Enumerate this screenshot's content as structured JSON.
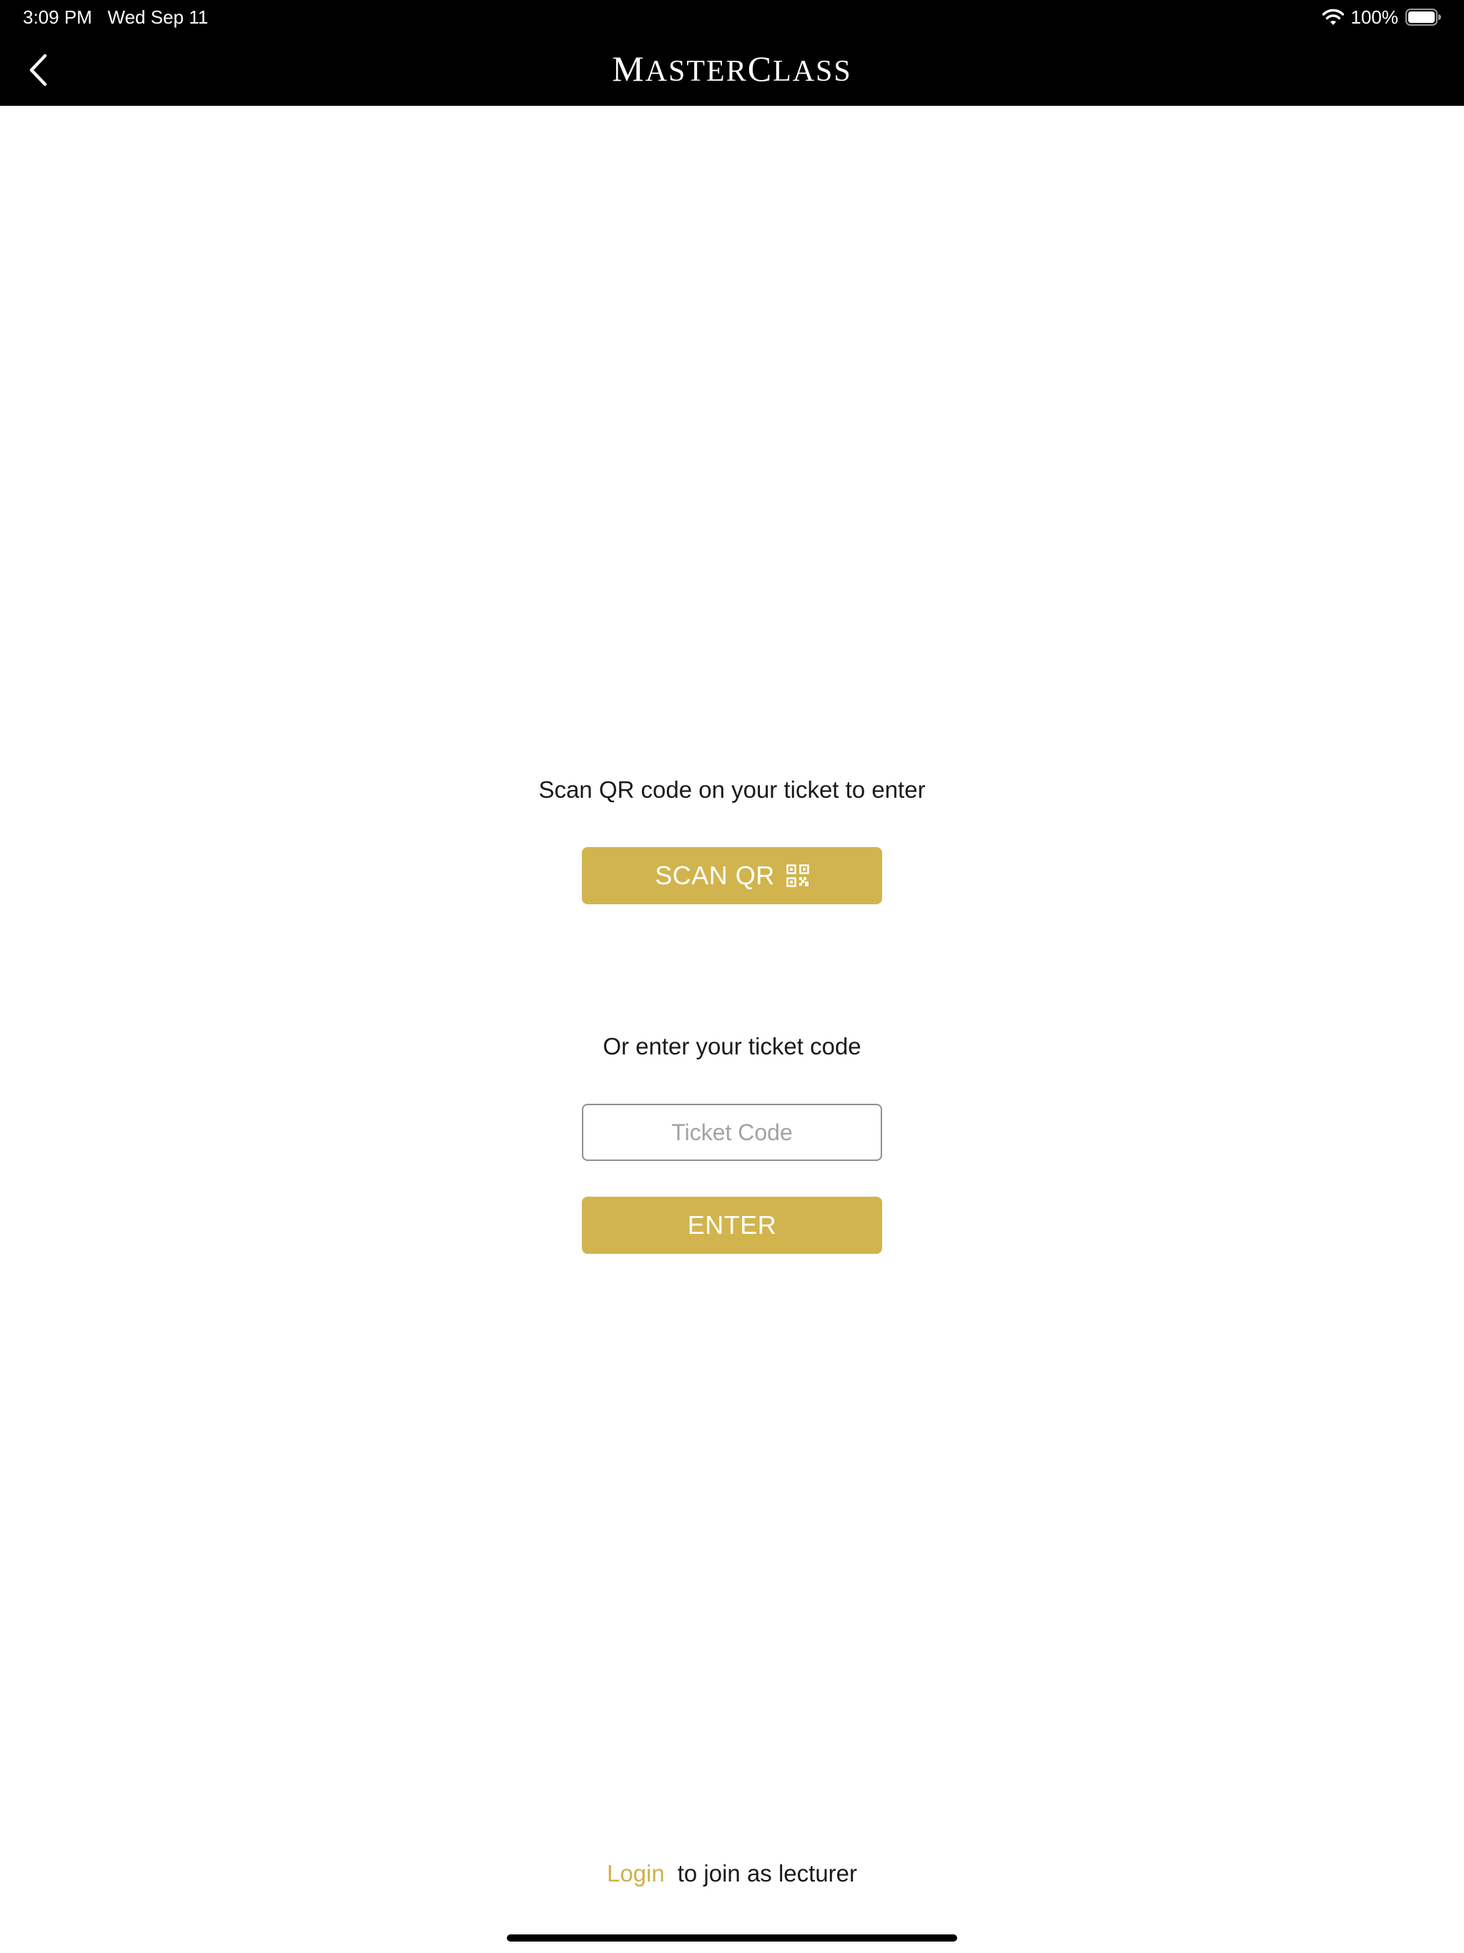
{
  "status_bar": {
    "time": "3:09 PM",
    "date": "Wed Sep 11",
    "battery_percent": "100%",
    "wifi_icon": "wifi-icon",
    "battery_icon": "battery-icon"
  },
  "nav": {
    "back_icon": "chevron-left-icon",
    "brand_first": "M",
    "brand_mid": "ASTER",
    "brand_second": "C",
    "brand_end": "LASS"
  },
  "scan": {
    "label": "Scan QR code on your ticket to enter",
    "button_label": "SCAN QR",
    "button_icon": "qr-code-icon"
  },
  "ticket": {
    "label": "Or enter your ticket code",
    "placeholder": "Ticket Code",
    "value": "",
    "enter_label": "ENTER"
  },
  "footer": {
    "login_label": "Login",
    "suffix": "to join as lecturer"
  },
  "colors": {
    "accent_gold": "#d1b44d",
    "link_gold": "#cfb04a",
    "header_bg": "#000000"
  }
}
